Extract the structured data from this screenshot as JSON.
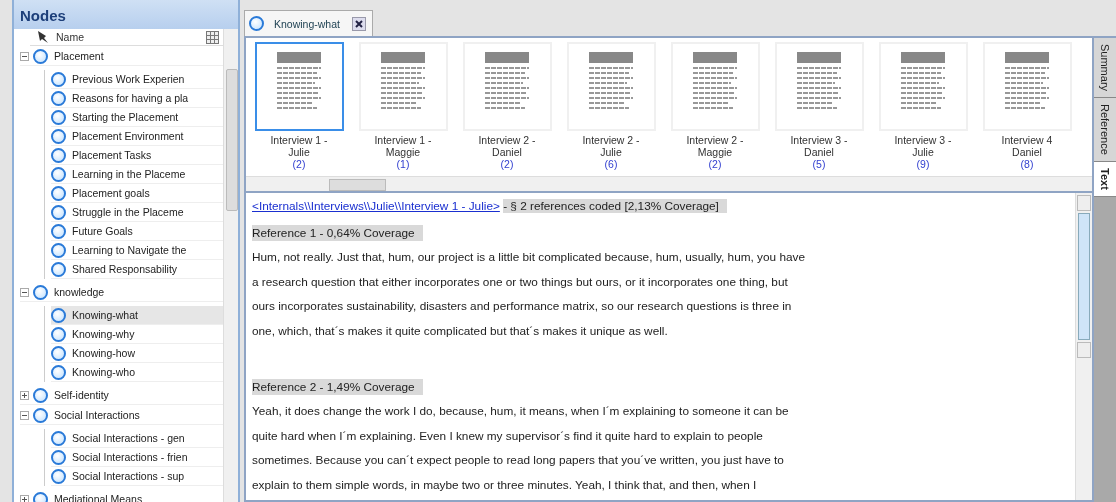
{
  "panel": {
    "title": "Nodes",
    "column": "Name"
  },
  "tree": [
    {
      "label": "Placement",
      "expanded": true,
      "selected": false,
      "children": [
        {
          "label": "Previous Work Experien",
          "selected": false
        },
        {
          "label": "Reasons for having a pla",
          "selected": false
        },
        {
          "label": "Starting the Placement",
          "selected": false
        },
        {
          "label": "Placement Environment",
          "selected": false
        },
        {
          "label": "Placement Tasks",
          "selected": false
        },
        {
          "label": "Learning in the Placeme",
          "selected": false
        },
        {
          "label": "Placement goals",
          "selected": false
        },
        {
          "label": "Struggle in the Placeme",
          "selected": false
        },
        {
          "label": "Future Goals",
          "selected": false
        },
        {
          "label": "Learning to Navigate the",
          "selected": false
        },
        {
          "label": "Shared Responsability",
          "selected": false
        }
      ]
    },
    {
      "label": "knowledge",
      "expanded": true,
      "selected": false,
      "children": [
        {
          "label": "Knowing-what",
          "selected": true
        },
        {
          "label": "Knowing-why",
          "selected": false
        },
        {
          "label": "Knowing-how",
          "selected": false
        },
        {
          "label": "Knowing-who",
          "selected": false
        }
      ]
    },
    {
      "label": "Self-identity",
      "expanded": false,
      "selected": false
    },
    {
      "label": "Social Interactions",
      "expanded": true,
      "selected": false,
      "children": [
        {
          "label": "Social Interactions - gen",
          "selected": false
        },
        {
          "label": "Social Interactions - frien",
          "selected": false
        },
        {
          "label": "Social Interactions - sup",
          "selected": false
        }
      ]
    },
    {
      "label": "Mediational Means",
      "expanded": false,
      "selected": false
    }
  ],
  "tabs": [
    {
      "label": "Knowing-what",
      "selected": true
    }
  ],
  "documents": [
    {
      "title": "Interview 1 -",
      "name": "Julie",
      "count": "(2)",
      "selected": true
    },
    {
      "title": "Interview 1 -",
      "name": "Maggie",
      "count": "(1)",
      "selected": false
    },
    {
      "title": "Interview 2 -",
      "name": "Daniel",
      "count": "(2)",
      "selected": false
    },
    {
      "title": "Interview 2 -",
      "name": "Julie",
      "count": "(6)",
      "selected": false
    },
    {
      "title": "Interview 2 -",
      "name": "Maggie",
      "count": "(2)",
      "selected": false
    },
    {
      "title": "Interview 3 -",
      "name": "Daniel",
      "count": "(5)",
      "selected": false
    },
    {
      "title": "Interview 3 -",
      "name": "Julie",
      "count": "(9)",
      "selected": false
    },
    {
      "title": "Interview 4",
      "name": "Daniel",
      "count": "(8)",
      "selected": false
    }
  ],
  "side_tabs": [
    {
      "label": "Summary",
      "selected": false
    },
    {
      "label": "Reference",
      "selected": false
    },
    {
      "label": "Text",
      "selected": true
    }
  ],
  "source": {
    "link": "<Internals\\\\Interviews\\\\Julie\\\\Interview 1 - Julie>",
    "summary": "- § 2 references coded  [2,13% Coverage]"
  },
  "references": [
    {
      "heading": "Reference 1 - 0,64% Coverage",
      "text": "Hum, not really. Just that, hum, our project is a little bit complicated because, hum, usually, hum, you have a research question that either incorporates one or two things but ours, or it incorporates one thing, but ours incorporates sustainability, disasters and performance matrix, so our research questions is three in one, which, that´s makes it quite complicated but that´s makes it unique as well."
    },
    {
      "heading": "Reference 2 - 1,49% Coverage",
      "text": "Yeah, it does change the work I do, because, hum, it means, when I´m explaining to someone it can be quite hard when I´m explaining. Even I knew my supervisor´s find it quite hard to explain to people sometimes. Because you can´t expect people to read long papers that you´ve written, you just have to explain to them simple words, in maybe two or three minutes. Yeah, I think that, and then, when I"
    }
  ]
}
